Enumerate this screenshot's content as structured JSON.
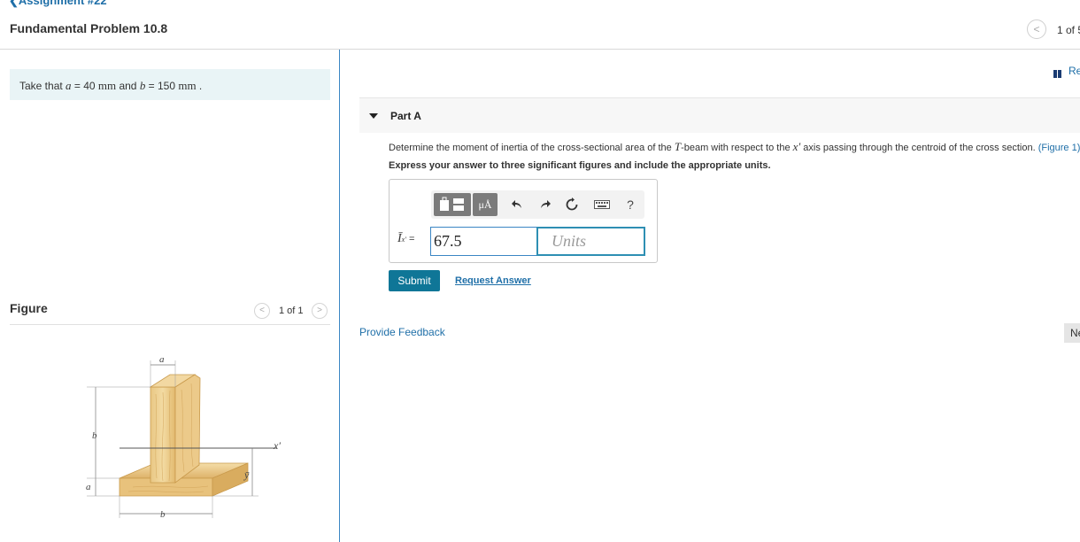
{
  "header": {
    "back_link": "❮Assignment #22",
    "problem_title": "Fundamental Problem 10.8",
    "pager_prev": "<",
    "pager_text": "1 of 5"
  },
  "given": {
    "prefix": "Take that ",
    "a_var": "a",
    "a_eq": " = 40 ",
    "a_unit": "mm",
    "and": " and ",
    "b_var": "b",
    "b_eq": " = 150 ",
    "b_unit": "mm",
    "suffix": " ."
  },
  "figure_panel": {
    "title": "Figure",
    "prev": "<",
    "count": "1 of 1",
    "next": ">",
    "labels": {
      "a_top": "a",
      "b_left": "b",
      "a_left": "a",
      "b_bottom": "b",
      "x_prime": "x′",
      "y_bar": "ȳ"
    }
  },
  "review": {
    "label": "Review"
  },
  "part": {
    "label": "Part A",
    "question_pre": "Determine the moment of inertia of the cross-sectional area of the ",
    "question_T": "T",
    "question_mid": "-beam with respect to the ",
    "question_x": "x′",
    "question_post": " axis passing through the centroid of the cross section. ",
    "figure_link": "(Figure 1)",
    "instruction": "Express your answer to three significant figures and include the appropriate units."
  },
  "toolbar": {
    "units_label": "μÅ",
    "help_label": "?",
    "icons": [
      "templates-icon",
      "units-icon",
      "undo-icon",
      "redo-icon",
      "reset-icon",
      "keyboard-icon",
      "help-icon"
    ]
  },
  "answer": {
    "label_var": "Ī",
    "label_sub": "x′",
    "label_eq": " = ",
    "value": "67.5",
    "units_placeholder": "Units"
  },
  "actions": {
    "submit": "Submit",
    "request_answer": "Request Answer",
    "provide_feedback": "Provide Feedback",
    "next": "Next"
  },
  "colors": {
    "link": "#1f6fa8",
    "submit_bg": "#0f7697",
    "given_bg": "#e9f4f6",
    "divider": "#3b86c4",
    "units_border": "#2e8fb3"
  }
}
